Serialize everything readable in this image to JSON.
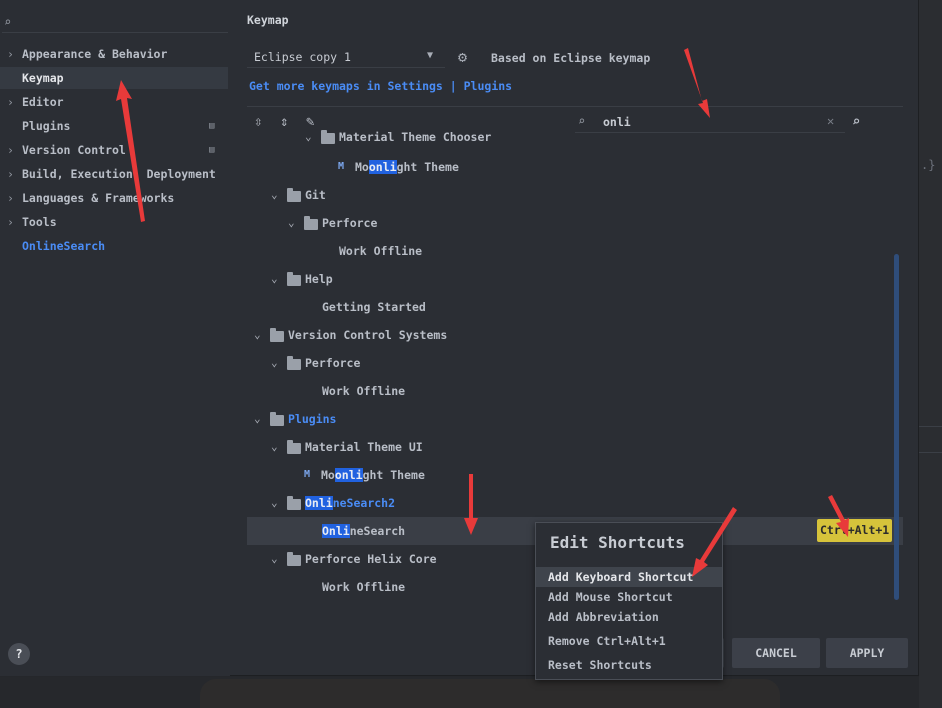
{
  "sidebar": {
    "items": [
      {
        "label": "Appearance & Behavior",
        "arrow": "›",
        "icon": ""
      },
      {
        "label": "Keymap",
        "arrow": "",
        "icon": ""
      },
      {
        "label": "Editor",
        "arrow": "›",
        "icon": ""
      },
      {
        "label": "Plugins",
        "arrow": "",
        "icon": "▤"
      },
      {
        "label": "Version Control",
        "arrow": "›",
        "icon": "▤"
      },
      {
        "label": "Build, Execution, Deployment",
        "arrow": "›",
        "icon": ""
      },
      {
        "label": "Languages & Frameworks",
        "arrow": "›",
        "icon": ""
      },
      {
        "label": "Tools",
        "arrow": "›",
        "icon": ""
      },
      {
        "label": "OnlineSearch",
        "arrow": "",
        "icon": ""
      }
    ],
    "help": "?"
  },
  "header": {
    "title": "Keymap",
    "keymap_value": "Eclipse copy 1",
    "based_on": "Based on Eclipse keymap",
    "get_more": "Get more keymaps in Settings | Plugins"
  },
  "filter": {
    "value": "onli"
  },
  "tree": {
    "r0": {
      "text": "Material Theme Chooser"
    },
    "r1": {
      "pre": "Mo",
      "hl": "onli",
      "post": "ght Theme"
    },
    "r2": {
      "text": "Git"
    },
    "r3": {
      "text": "Perforce"
    },
    "r4": {
      "text": "Work Offline"
    },
    "r5": {
      "text": "Help"
    },
    "r6": {
      "text": "Getting Started"
    },
    "r7": {
      "text": "Version Control Systems"
    },
    "r8": {
      "text": "Perforce"
    },
    "r9": {
      "text": "Work Offline"
    },
    "r10": {
      "text": "Plugins"
    },
    "r11": {
      "text": "Material Theme UI"
    },
    "r12": {
      "pre": "Mo",
      "hl": "onli",
      "post": "ght Theme"
    },
    "r13": {
      "hl": "Onli",
      "post": "neSearch2"
    },
    "r14": {
      "hl": "Onli",
      "post": "neSearch",
      "shortcut": "Ctrl+Alt+1"
    },
    "r15": {
      "text": "Perforce Helix Core"
    },
    "r16": {
      "text": "Work Offline"
    }
  },
  "buttons": {
    "cancel": "CANCEL",
    "apply": "APPLY"
  },
  "popup": {
    "title": "Edit Shortcuts",
    "items": [
      "Add Keyboard Shortcut",
      "Add Mouse Shortcut",
      "Add Abbreviation",
      "Remove Ctrl+Alt+1",
      "Reset Shortcuts"
    ]
  },
  "colors": {
    "accent": "#4a8cf5",
    "highlight": "#2162e0",
    "shortcut_badge": "#d6c33b",
    "annotation_arrow": "#e83a3a"
  },
  "icons": {
    "search": "search-icon",
    "gear": "gear-icon",
    "folder": "folder-icon",
    "moonlight": "material-theme-icon"
  }
}
